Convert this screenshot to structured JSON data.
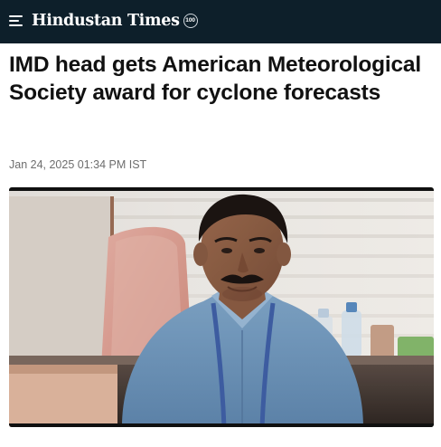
{
  "header": {
    "brand": "Hindustan Times",
    "badge": "100",
    "menu_icon": "hamburger-menu-icon"
  },
  "article": {
    "headline": "IMD head gets American Meteorological Society award for cyclone forecasts",
    "timestamp": "Jan 24, 2025 01:34 PM IST"
  },
  "colors": {
    "header_bg": "#0d1f2a",
    "headline": "#111111",
    "timestamp": "#6d6d6d"
  }
}
